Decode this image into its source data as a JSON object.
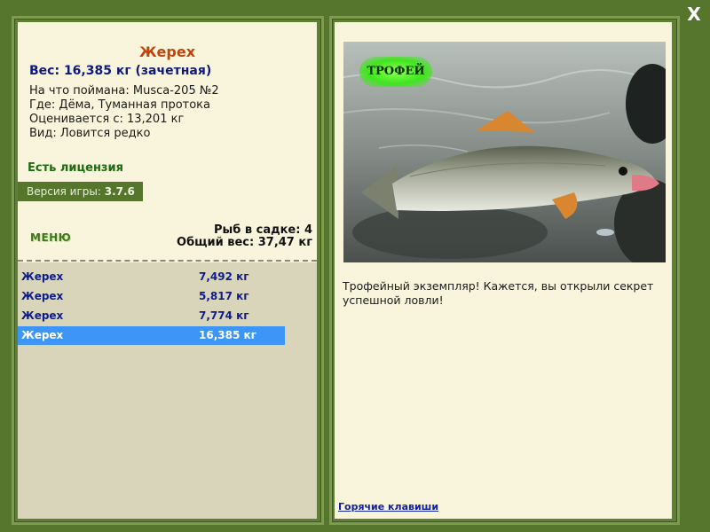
{
  "window": {
    "close_label": "X"
  },
  "fish": {
    "name": "Жерех",
    "weight_line": "Вес: 16,385 кг (зачетная)",
    "caught_on": "На что поймана: Musca-205 №2",
    "location": "Где: Дёма, Туманная протока",
    "threshold": "Оценивается с: 13,201 кг",
    "rarity": "Вид: Ловится редко"
  },
  "license": "Есть лицензия",
  "version": {
    "label": "Версия игры:",
    "value": "3.7.6"
  },
  "menu_label": "МЕНЮ",
  "keepnet": {
    "count": "Рыб в садке: 4",
    "total_weight": "Общий вес: 37,47 кг"
  },
  "catch_list": [
    {
      "name": "Жерех",
      "weight": "7,492 кг",
      "selected": false
    },
    {
      "name": "Жерех",
      "weight": "5,817 кг",
      "selected": false
    },
    {
      "name": "Жерех",
      "weight": "7,774 кг",
      "selected": false
    },
    {
      "name": "Жерех",
      "weight": "16,385 кг",
      "selected": true
    }
  ],
  "photo": {
    "badge": "ТРОФЕЙ"
  },
  "description": "Трофейный экземпляр! Кажется, вы открыли секрет успешной ловли!",
  "hotkeys_link": "Горячие клавиши",
  "colors": {
    "frame": "#56752d",
    "panel_bg": "#f8f5dc",
    "list_bg": "#d9d5bb",
    "title": "#c0440c",
    "weight": "#101a7a",
    "license": "#1f6a12",
    "selection": "#3d96f7"
  }
}
